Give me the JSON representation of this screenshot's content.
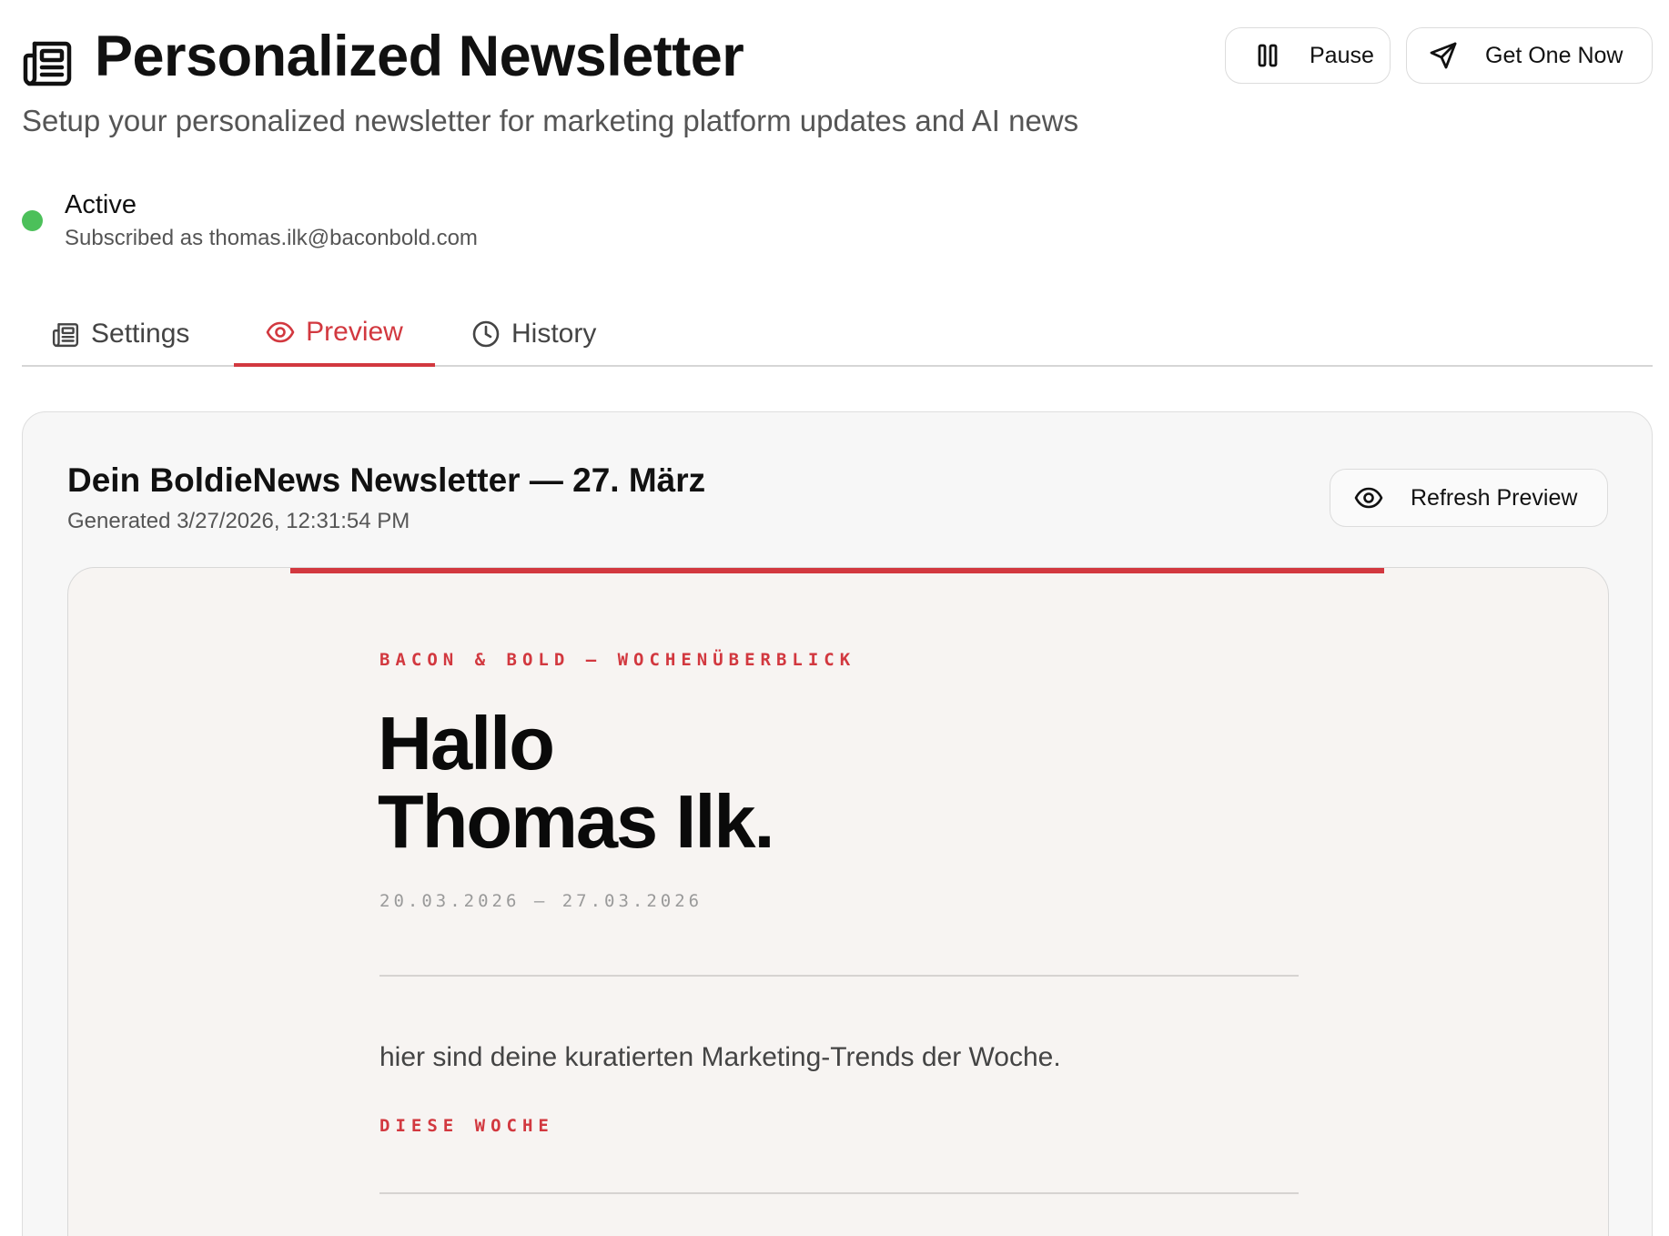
{
  "header": {
    "title": "Personalized Newsletter",
    "subtitle": "Setup your personalized newsletter for marketing platform updates and AI news",
    "icon": "newspaper-icon"
  },
  "actions": {
    "pause_label": "Pause",
    "pause_icon": "pause-icon",
    "get_one_label": "Get One Now",
    "get_one_icon": "send-icon"
  },
  "status": {
    "label": "Active",
    "detail": "Subscribed as thomas.ilk@baconbold.com",
    "color": "#4cc05a"
  },
  "tabs": [
    {
      "label": "Settings",
      "icon": "newspaper-icon",
      "active": false
    },
    {
      "label": "Preview",
      "icon": "eye-icon",
      "active": true
    },
    {
      "label": "History",
      "icon": "clock-icon",
      "active": false
    }
  ],
  "preview_card": {
    "title": "Dein BoldieNews Newsletter — 27. März",
    "generated": "Generated 3/27/2026, 12:31:54 PM",
    "refresh_label": "Refresh Preview",
    "refresh_icon": "eye-icon"
  },
  "newsletter": {
    "kicker": "BACON & BOLD — WOCHENÜBERBLICK",
    "greeting_line1": "Hallo",
    "greeting_line2": "Thomas Ilk.",
    "date_range": "20.03.2026 — 27.03.2026",
    "intro": "hier sind deine kuratierten Marketing-Trends der Woche.",
    "section_label": "DIESE WOCHE"
  },
  "colors": {
    "accent": "#d2383f",
    "active_status": "#4cc05a",
    "text": "#111111",
    "muted": "#555555"
  }
}
